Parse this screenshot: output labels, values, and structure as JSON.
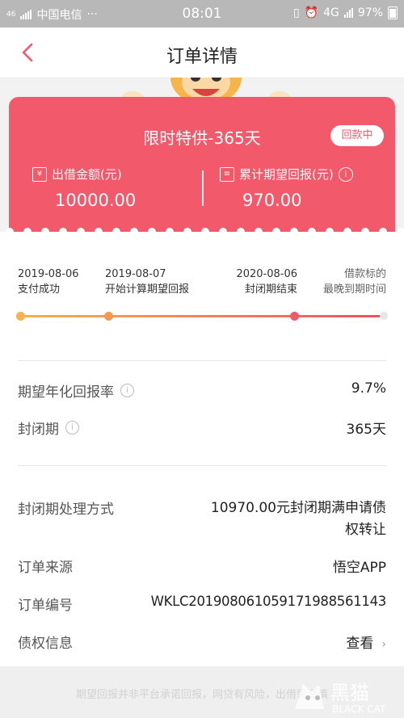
{
  "status": {
    "signal_label": "46",
    "carrier": "中国电信",
    "time": "08:01",
    "network": "4G",
    "battery": "97%"
  },
  "nav": {
    "title": "订单详情",
    "back_icon": "chevron-left-icon"
  },
  "card": {
    "title": "限时特供-365天",
    "badge": "回款中",
    "amount_label": "出借金额(元)",
    "amount_icon_text": "¥",
    "amount_value": "10000.00",
    "return_label": "累计期望回报(元)",
    "return_value": "970.00",
    "info_icon_text": "i",
    "background": "#f2596b"
  },
  "timeline": {
    "steps": [
      {
        "date": "2019-08-06",
        "label": "支付成功"
      },
      {
        "date": "2019-08-07",
        "label": "开始计算期望回报"
      },
      {
        "date": "2020-08-06",
        "label": "封闭期结束"
      },
      {
        "date": "借款标的",
        "label": "最晚到期时间"
      }
    ],
    "colors": [
      "#f6b24c",
      "#f49a4f",
      "#ee5a66",
      "#e6e6e6"
    ]
  },
  "details": {
    "rate_label": "期望年化回报率",
    "rate_value": "9.7%",
    "period_label": "封闭期",
    "period_value": "365天",
    "handling_label": "封闭期处理方式",
    "handling_value_line1": "10970.00元封闭期满申请债",
    "handling_value_line2": "权转让",
    "source_label": "订单来源",
    "source_value": "悟空APP",
    "order_no_label": "订单编号",
    "order_no_value": "WKLC2019080610591719885611​43",
    "claim_label": "债权信息",
    "claim_action": "查看",
    "help_icon_text": "i"
  },
  "footer": {
    "disclaimer": "期望回报并非平台承诺回报，网贷有风险，出借需谨慎",
    "watermark_cn": "黑猫",
    "watermark_en": "BLACK CAT"
  }
}
